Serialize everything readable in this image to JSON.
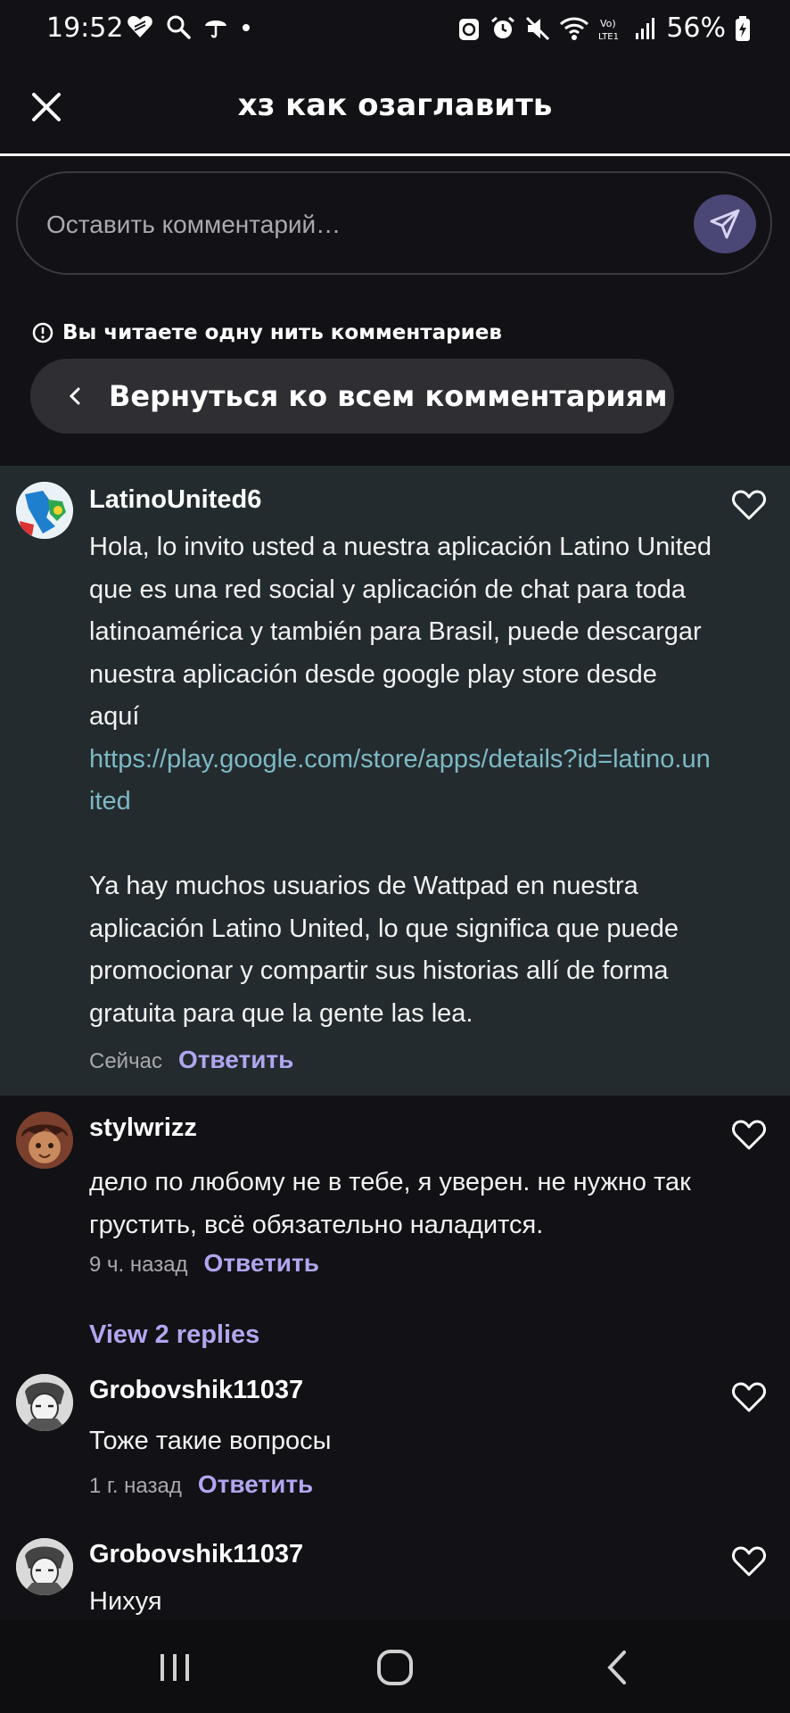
{
  "status_bar": {
    "time": "19:52",
    "battery": "56%",
    "icons_left": [
      "heart-shield-icon",
      "search-icon",
      "umbrella-icon",
      "dot-icon"
    ],
    "icons_right": [
      "recycle-icon",
      "alarm-icon",
      "mute-icon",
      "wifi-icon",
      "volte-icon",
      "signal-icon",
      "battery-icon"
    ]
  },
  "header": {
    "title": "хз как озаглавить",
    "close_icon": "close-icon"
  },
  "comment_input": {
    "placeholder": "Оставить комментарий…",
    "send_icon": "send-icon"
  },
  "thread": {
    "notice": "Вы читаете одну нить комментариев",
    "back_label": "Вернуться ко всем комментариям"
  },
  "comments": [
    {
      "username": "LatinoUnited6",
      "paragraph1": "Hola, lo invito usted a nuestra aplicación Latino United que es una red social y aplicación de chat para toda latinoamérica y también para Brasil, puede descargar nuestra aplicación desde google play store desde aquí",
      "link": "https://play.google.com/store/apps/details?id=latino.united",
      "paragraph2": "Ya hay muchos usuarios de Wattpad en nuestra aplicación Latino United, lo que significa que puede promocionar y compartir sus historias allí de forma gratuita para que la gente las lea.",
      "time": "Сейчас",
      "reply": "Ответить"
    },
    {
      "username": "stylwrizz",
      "text": "дело по любому не в тебе, я уверен. не нужно так грустить, всё обязательно наладится.",
      "time": "9 ч. назад",
      "reply": "Ответить"
    },
    {
      "username": "Grobovshik11037",
      "text": "Тоже такие вопросы",
      "time": "1 г. назад",
      "reply": "Ответить"
    },
    {
      "username": "Grobovshik11037",
      "text": "Нихуя"
    }
  ],
  "view_replies": "View 2 replies",
  "nav": {
    "recent_icon": "recent-apps-icon",
    "home_icon": "home-icon",
    "back_icon": "back-icon"
  },
  "colors": {
    "background": "#121115",
    "highlight": "#242b2e",
    "accent": "#b0a6f0",
    "link": "#7cb9c5",
    "send_button": "#4a4675"
  }
}
